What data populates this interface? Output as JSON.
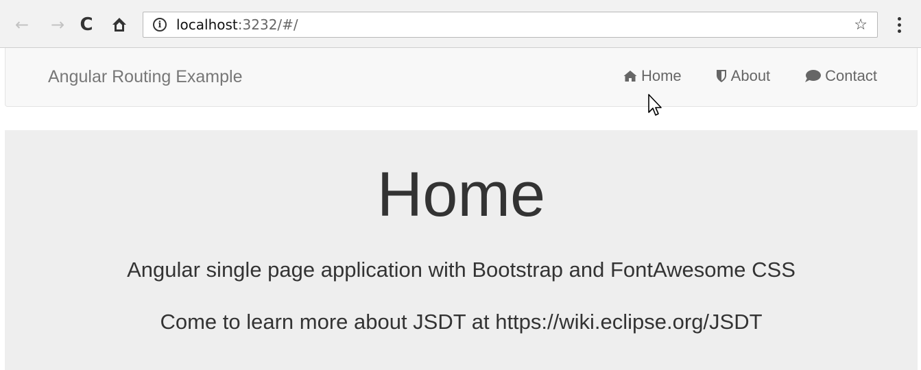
{
  "browser": {
    "url_host": "localhost",
    "url_rest": ":3232/#/",
    "icons": [
      "back-arrow-icon",
      "forward-arrow-icon",
      "reload-icon",
      "home-icon",
      "info-icon",
      "star-icon",
      "menu-icon"
    ]
  },
  "navbar": {
    "brand": "Angular Routing Example",
    "links": [
      {
        "label": "Home",
        "icon": "home-icon"
      },
      {
        "label": "About",
        "icon": "shield-icon"
      },
      {
        "label": "Contact",
        "icon": "comment-icon"
      }
    ]
  },
  "jumbotron": {
    "title": "Home",
    "line1": "Angular single page application with Bootstrap and FontAwesome CSS",
    "line2": "Come to learn more about JSDT at https://wiki.eclipse.org/JSDT"
  },
  "colors": {
    "navbar_bg": "#f8f8f8",
    "jumbotron_bg": "#eeeeee",
    "text": "#333333",
    "nav_text": "#777777"
  }
}
